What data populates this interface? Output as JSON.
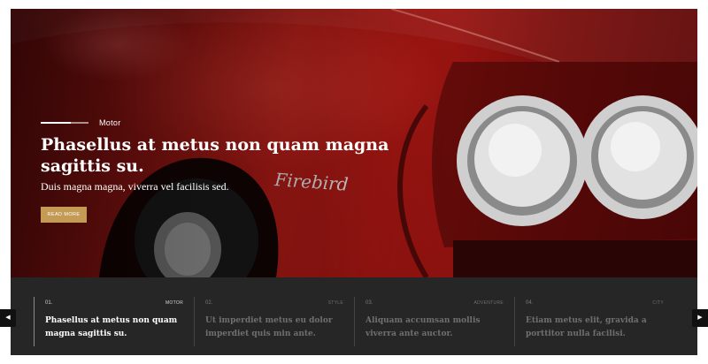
{
  "hero": {
    "category": "Motor",
    "title": "Phasellus at metus non quam magna sagittis su.",
    "subtitle": "Duis magna magna, viverra vel facilisis sed.",
    "button_label": "READ MORE",
    "emblem_text": "Firebird",
    "accent_color": "#c49b55"
  },
  "carousel": {
    "prev_icon": "◀",
    "next_icon": "▶",
    "slides": [
      {
        "num": "01.",
        "tag": "MOTOR",
        "title": "Phasellus at metus non quam magna sagittis su.",
        "active": true
      },
      {
        "num": "02.",
        "tag": "STYLE",
        "title": "Ut imperdiet metus eu dolor imperdiet quis min ante.",
        "active": false
      },
      {
        "num": "03.",
        "tag": "ADVENTURE",
        "title": "Aliquam accumsan mollis viverra ante auctor.",
        "active": false
      },
      {
        "num": "04.",
        "tag": "CITY",
        "title": "Etiam metus elit, gravida a porttitor nulla facilisi.",
        "active": false
      }
    ]
  }
}
